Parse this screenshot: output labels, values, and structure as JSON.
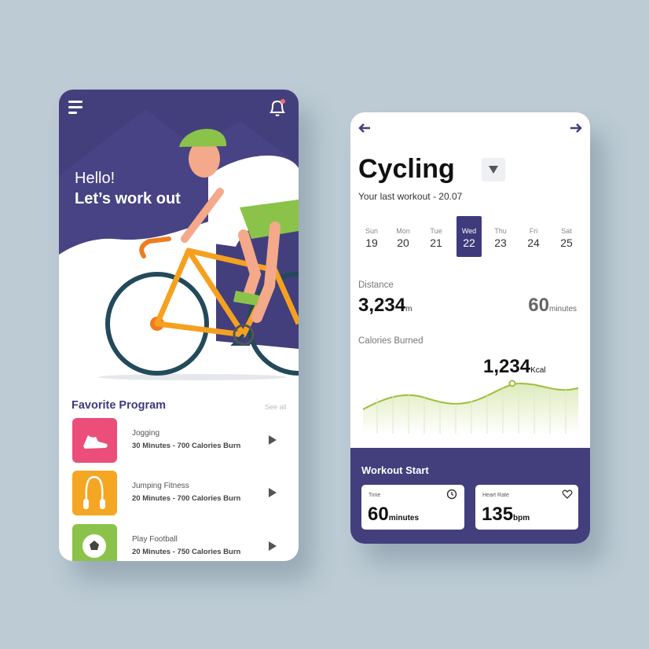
{
  "colors": {
    "accent": "#433f7d",
    "background": "#bccbd4",
    "chart_line": "#9cbf3a"
  },
  "home": {
    "greeting": "Hello!",
    "headline": "Let’s work out",
    "menu_icon": "hamburger-menu-icon",
    "notification_icon": "bell-icon",
    "favorite_title": "Favorite Program",
    "see_all": "See all",
    "programs": [
      {
        "name": "Jogging",
        "details": "30 Minutes - 700 Calories Burn",
        "icon": "sneaker-icon",
        "color": "#ec4e7a"
      },
      {
        "name": "Jumping Fitness",
        "details": "20 Minutes - 700 Calories Burn",
        "icon": "jump-rope-icon",
        "color": "#f5a623"
      },
      {
        "name": "Play Football",
        "details": "20 Minutes - 750 Calories Burn",
        "icon": "football-icon",
        "color": "#8bc34a"
      }
    ]
  },
  "detail": {
    "title": "Cycling",
    "subtitle": "Your last workout - 20.07",
    "days": [
      {
        "name": "Sun",
        "date": "19"
      },
      {
        "name": "Mon",
        "date": "20"
      },
      {
        "name": "Tue",
        "date": "21"
      },
      {
        "name": "Wed",
        "date": "22",
        "selected": true
      },
      {
        "name": "Thu",
        "date": "23"
      },
      {
        "name": "Fri",
        "date": "24"
      },
      {
        "name": "Sat",
        "date": "25"
      }
    ],
    "distance_label": "Distance",
    "distance_value": "3,234",
    "distance_unit": "m",
    "duration_value": "60",
    "duration_unit": "minutes",
    "calories_label": "Calories Burned",
    "calories_value": "1,234",
    "calories_unit": "Kcal",
    "workout_title": "Workout Start",
    "time_label": "Time",
    "time_value": "60",
    "time_unit": "minutes",
    "heart_label": "Heart Rate",
    "heart_value": "135",
    "heart_unit": "bpm"
  }
}
